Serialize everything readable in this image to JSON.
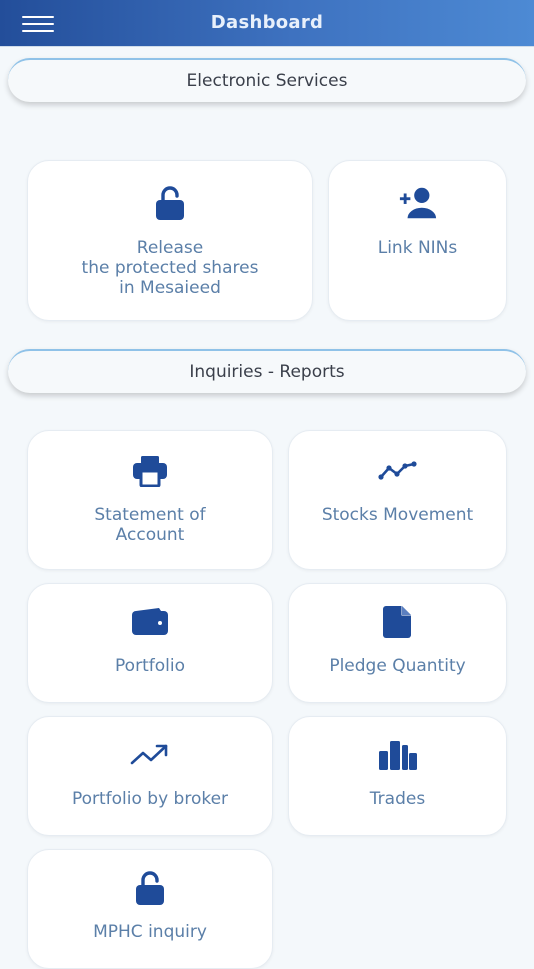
{
  "appbar": {
    "title": "Dashboard"
  },
  "sections": {
    "electronic_services": "Electronic Services",
    "inquiries_reports": "Inquiries - Reports"
  },
  "cards": {
    "release": "Release\nthe protected shares\nin Mesaieed",
    "link_nins": "Link NINs",
    "statement": "Statement of\nAccount",
    "stocks_movement": "Stocks Movement",
    "portfolio": "Portfolio",
    "pledge": "Pledge Quantity",
    "portfolio_broker": "Portfolio by broker",
    "trades": "Trades",
    "mphc": "MPHC inquiry"
  },
  "icons": {
    "release": "unlock-icon",
    "link_nins": "add-user-icon",
    "statement": "printer-icon",
    "stocks_movement": "line-chart-icon",
    "portfolio": "wallet-icon",
    "pledge": "document-icon",
    "portfolio_broker": "trending-up-icon",
    "trades": "bar-chart-icon",
    "mphc": "unlock-icon"
  },
  "colors": {
    "appbar_start": "#234e9a",
    "appbar_end": "#4d8ad4",
    "icon": "#1f4b99",
    "label": "#5b7fa8",
    "background": "#f4f8fb"
  }
}
